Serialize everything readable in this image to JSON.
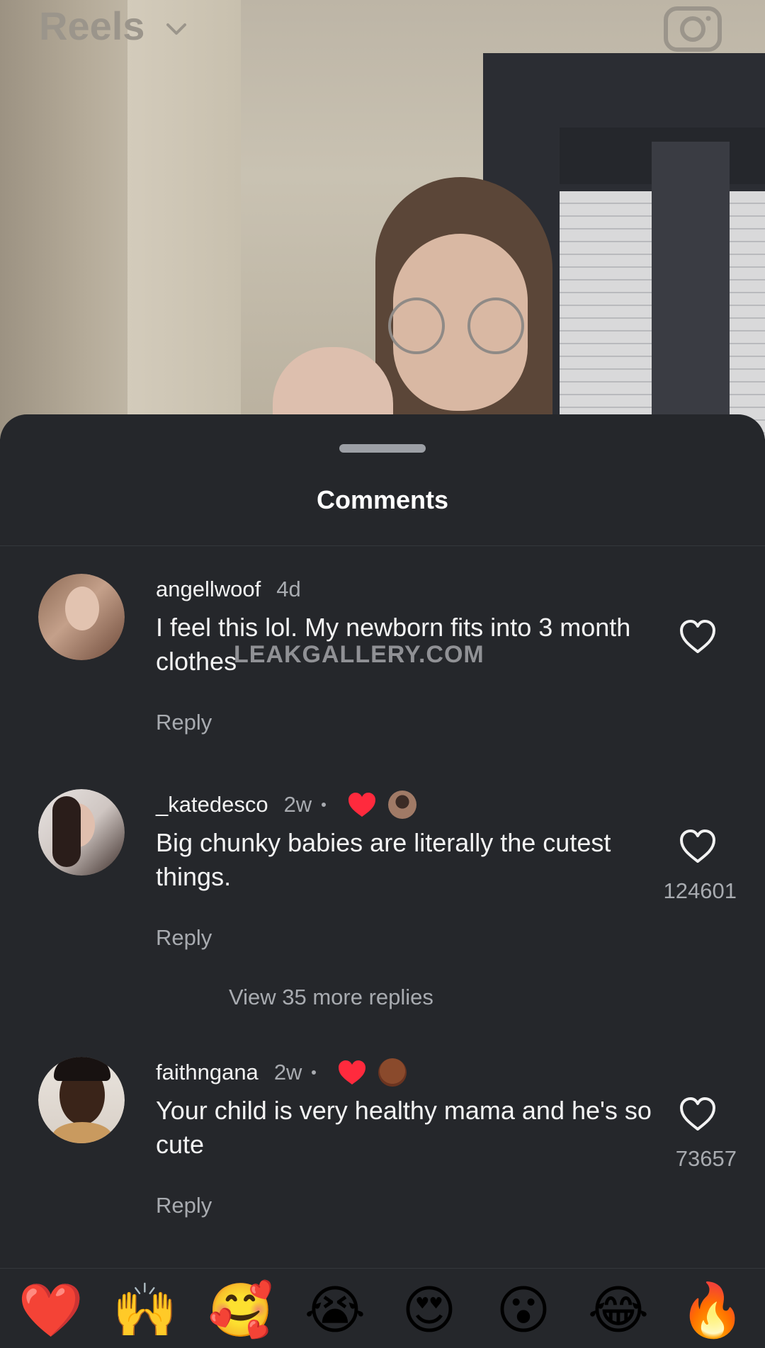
{
  "header": {
    "title": "Reels"
  },
  "sheet": {
    "title": "Comments",
    "watermark": "LEAKGALLERY.COM"
  },
  "comments": [
    {
      "username": "angellwoof",
      "time": "4d",
      "text": "I feel this lol. My newborn fits into 3 month clothes",
      "reply_label": "Reply",
      "likes": ""
    },
    {
      "username": "_katedesco",
      "time": "2w",
      "text": "Big chunky babies are literally the cutest things.",
      "reply_label": "Reply",
      "likes": "124601"
    },
    {
      "username": "faithngana",
      "time": "2w",
      "text": "Your child is very healthy mama and he's so cute",
      "reply_label": "Reply",
      "likes": "73657"
    }
  ],
  "view_more_replies": "View 35 more replies",
  "emoji_bar": {
    "items": [
      "❤️",
      "🙌",
      "🥰",
      "😭",
      "😍",
      "😮",
      "😂",
      "🔥"
    ]
  },
  "colors": {
    "sheet_bg": "#25272b",
    "text_primary": "#f4f4f4",
    "text_secondary": "#a8abb0",
    "creator_heart": "#ff2a3d"
  }
}
